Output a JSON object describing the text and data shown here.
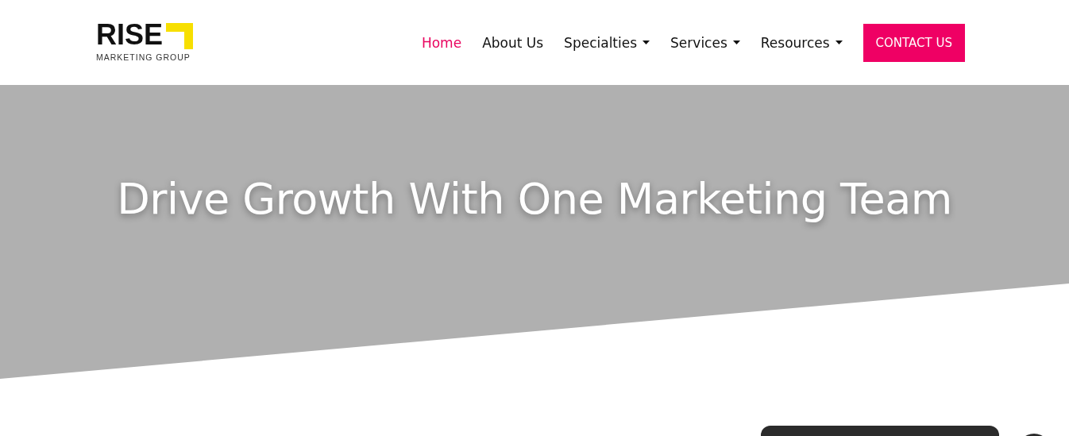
{
  "logo": {
    "name": "RISE",
    "tagline": "MARKETING GROUP"
  },
  "nav": [
    {
      "label": "Home",
      "selected": true,
      "dropdown": false
    },
    {
      "label": "About Us",
      "selected": false,
      "dropdown": false
    },
    {
      "label": "Specialties",
      "selected": false,
      "dropdown": true
    },
    {
      "label": "Services",
      "selected": false,
      "dropdown": true
    },
    {
      "label": "Resources",
      "selected": false,
      "dropdown": true
    }
  ],
  "cta": "CONTACT US",
  "hero": {
    "title": "Drive Growth With One Marketing Team"
  }
}
